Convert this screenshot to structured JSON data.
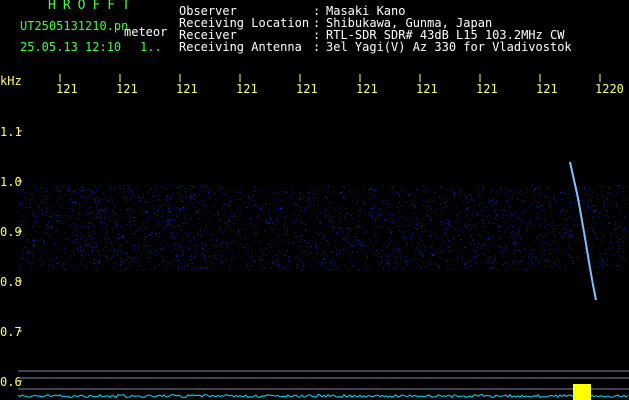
{
  "header": {
    "brand": "HROFFT",
    "filename": "UT2505131210.pn",
    "file_type": "meteor",
    "datetime": "25.05.13 12:10",
    "counter": "1.."
  },
  "meta": {
    "labels": [
      "Observer",
      "Receiving Location",
      "Receiver",
      "Receiving Antenna"
    ],
    "separator": ":",
    "values": [
      "Masaki Kano",
      "Shibukawa, Gunma, Japan",
      "RTL-SDR SDR# 43dB L15 103.2MHz CW",
      "3el Yagi(V) Az 330 for Vladivostok"
    ]
  },
  "axes": {
    "y_unit": "kHz",
    "y_ticks": [
      "1.1",
      "1.0",
      "0.9",
      "0.8",
      "0.7",
      "0.6"
    ],
    "x_ticks": [
      "121",
      "121",
      "121",
      "121",
      "121",
      "121",
      "121",
      "121",
      "121",
      "1220"
    ]
  },
  "colors": {
    "background": "#000000",
    "brand": "#3cff3c",
    "text": "#ffffff",
    "tick": "#ffff66",
    "noise": "#2030ff",
    "echo": "#80c0ff",
    "baseline": "#00e0ff",
    "burst": "#ffff00"
  }
}
